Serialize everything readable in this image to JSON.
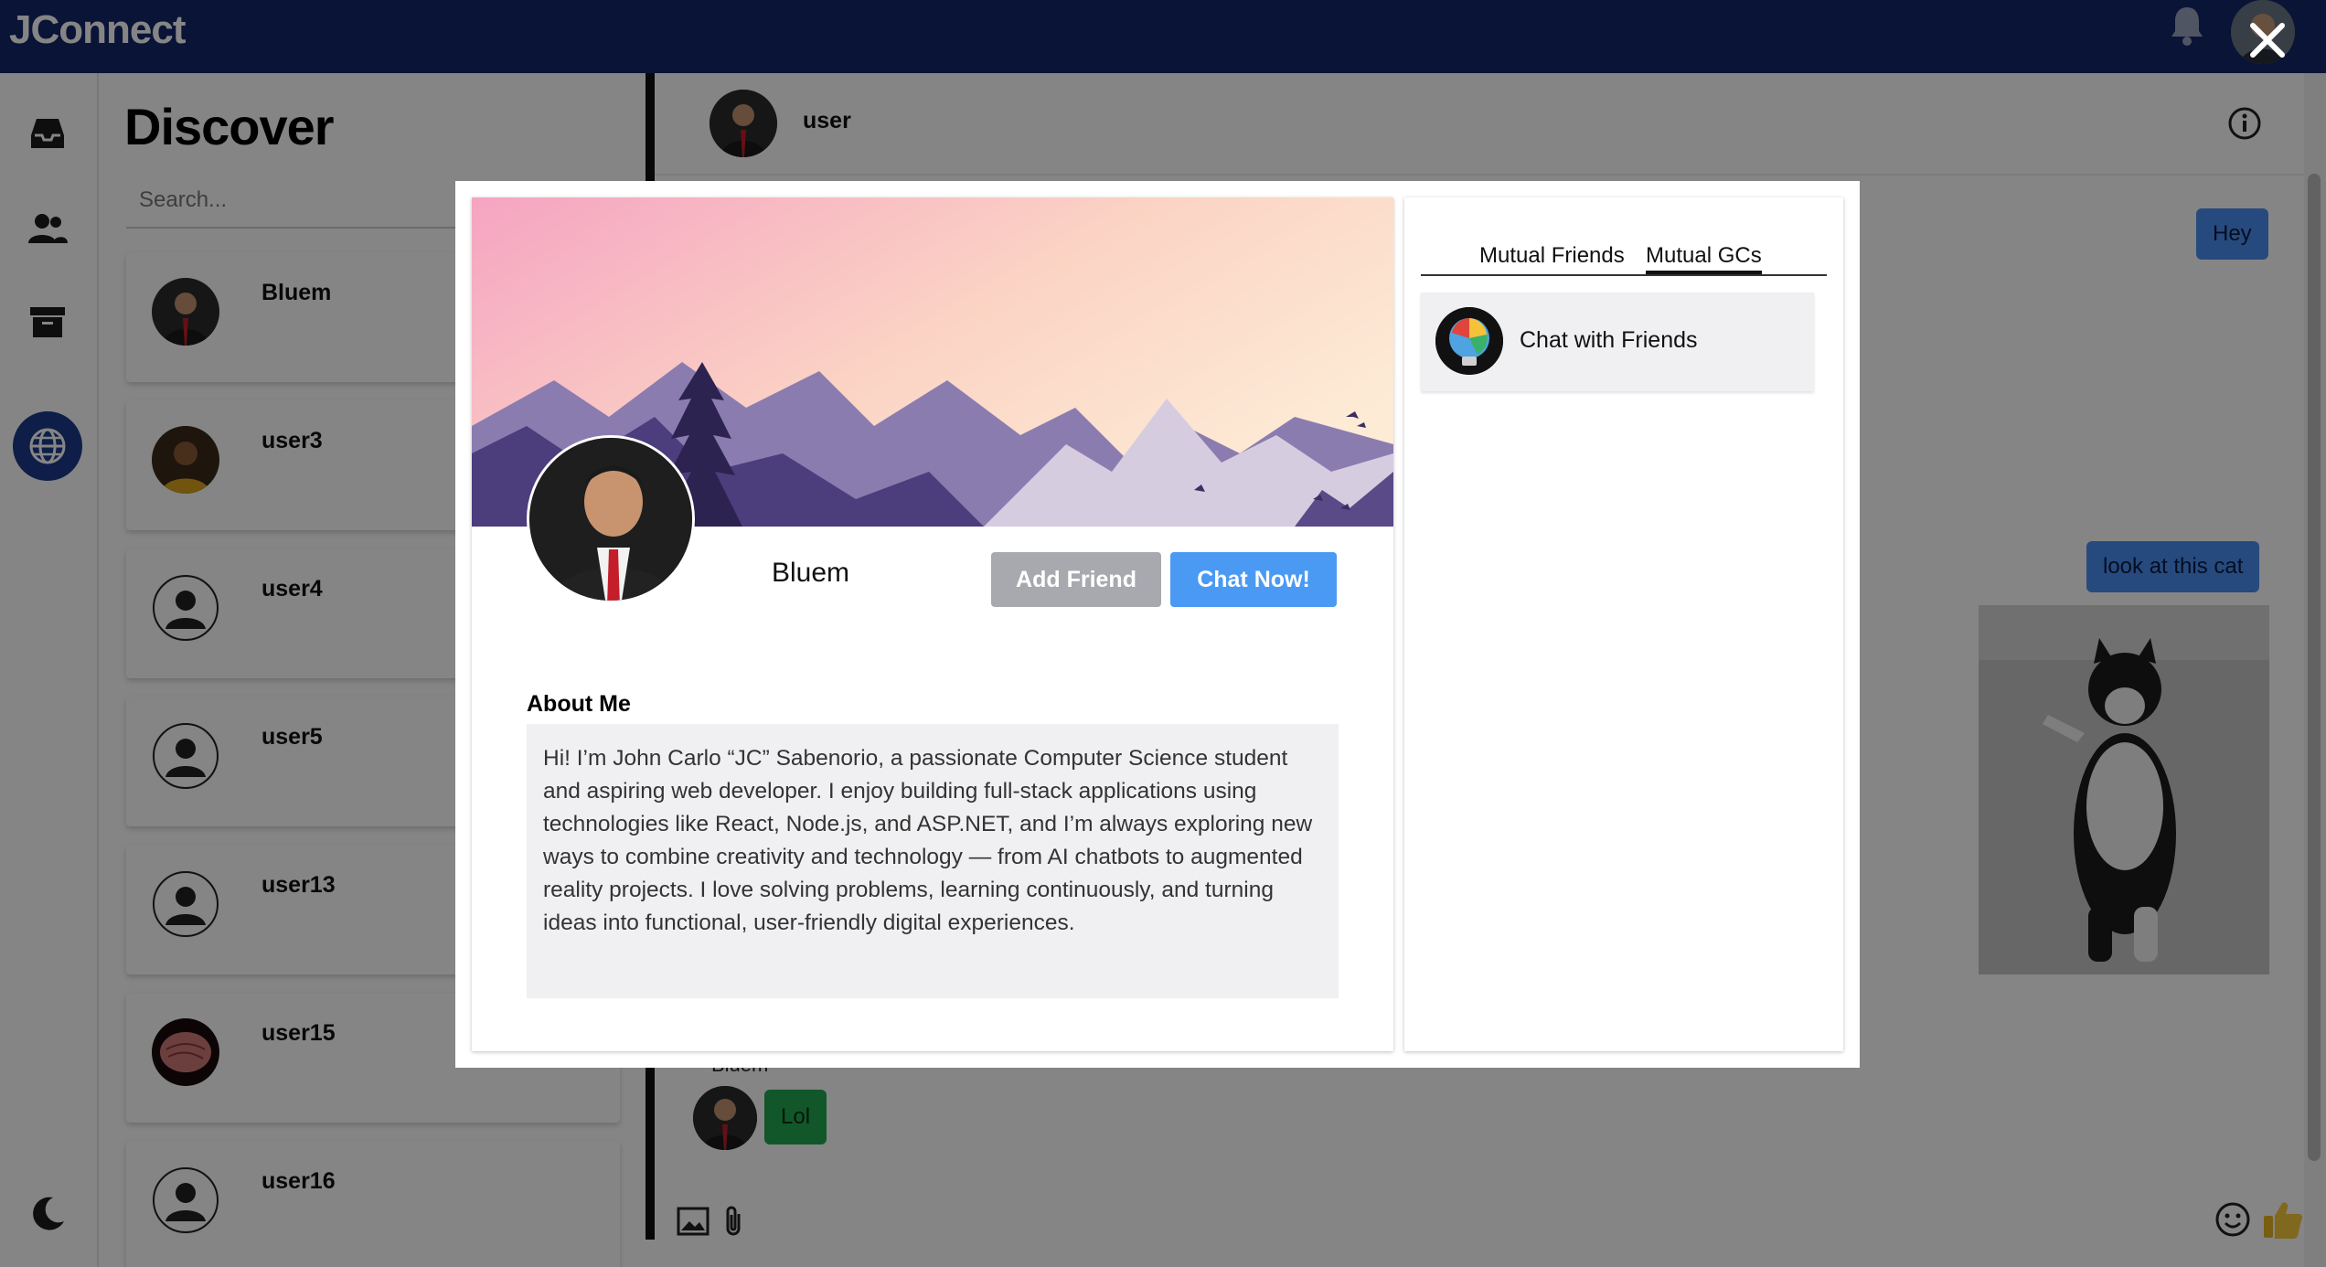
{
  "app": {
    "title": "JConnect"
  },
  "discover": {
    "title": "Discover",
    "search_placeholder": "Search...",
    "users": [
      {
        "name": "Bluem"
      },
      {
        "name": "user3"
      },
      {
        "name": "user4"
      },
      {
        "name": "user5"
      },
      {
        "name": "user13"
      },
      {
        "name": "user15"
      },
      {
        "name": "user16"
      }
    ]
  },
  "chat": {
    "name": "user",
    "messages": {
      "out_1": "Hey",
      "out_2": "look at this cat",
      "in_sender": "Bluem",
      "in_1": "Lol"
    }
  },
  "profile": {
    "name": "Bluem",
    "add_friend_label": "Add Friend",
    "chat_now_label": "Chat Now!",
    "about_title": "About Me",
    "about_text": "Hi! I’m John Carlo “JC” Sabenorio, a passionate Computer Science student and aspiring web developer. I enjoy building full-stack applications using technologies like React, Node.js, and ASP.NET, and I’m always exploring new ways to combine creativity and technology — from AI chatbots to augmented reality projects. I love solving problems, learning continuously, and turning ideas into functional, user-friendly digital experiences.",
    "tabs": [
      "Mutual Friends",
      "Mutual GCs"
    ],
    "active_tab": "Mutual GCs",
    "group_chats": [
      {
        "name": "Chat with Friends"
      }
    ]
  },
  "colors": {
    "topbar": "#12286a",
    "accent_blue": "#4a9af4",
    "button_gray": "#a8a9af",
    "incoming_green": "#23a84f"
  },
  "icons": {
    "topbar": [
      "bell-icon",
      "avatar"
    ],
    "rail": [
      "inbox-icon",
      "people-icon",
      "archive-icon",
      "globe-icon",
      "moon-icon"
    ],
    "chat": [
      "info-icon",
      "image-icon",
      "paperclip-icon",
      "emoji-icon",
      "thumbs-up-icon"
    ],
    "modal": [
      "close-icon"
    ]
  }
}
